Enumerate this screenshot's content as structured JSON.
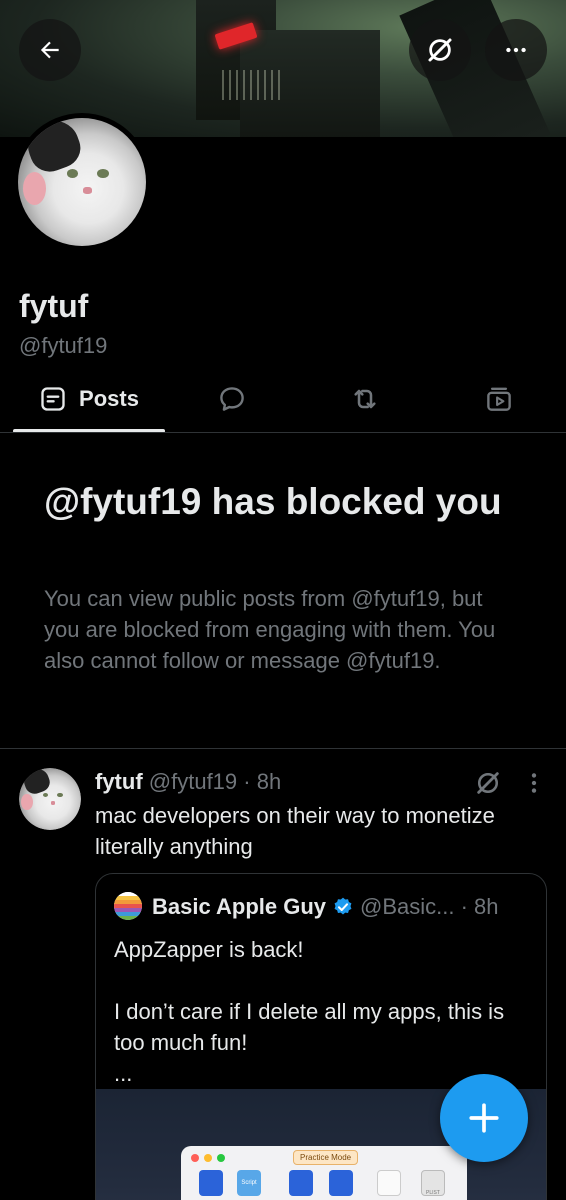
{
  "header": {
    "back_icon": "arrow-left-icon",
    "grok_icon": "grok-icon",
    "more_icon": "more-horizontal-icon"
  },
  "profile": {
    "display_name": "fytuf",
    "handle": "@fytuf19"
  },
  "tabs": [
    {
      "label": "Posts",
      "icon": "posts-icon",
      "selected": true
    },
    {
      "label": "",
      "icon": "replies-icon",
      "selected": false
    },
    {
      "label": "",
      "icon": "reposts-icon",
      "selected": false
    },
    {
      "label": "",
      "icon": "media-icon",
      "selected": false
    }
  ],
  "blocked": {
    "title": "@fytuf19 has blocked you",
    "description": "You can view public posts from @fytuf19, but you are blocked from engaging with them. You also cannot follow or message @fytuf19."
  },
  "post": {
    "name": "fytuf",
    "meta": "@fytuf19 · 8h",
    "text": "mac developers on their way to monetize literally anything",
    "quote": {
      "name": "Basic Apple Guy",
      "meta": "@Basic... · 8h",
      "lines": [
        "AppZapper is back!",
        "",
        "I don’t care if I delete all my apps, this is too much fun!",
        "..."
      ],
      "media_badge": "Practice Mode",
      "media_labels": [
        "Script",
        "PLIST"
      ]
    }
  },
  "fab": {
    "icon": "plus-icon"
  },
  "colors": {
    "background": "#000000",
    "text_primary": "#e7e9ea",
    "text_secondary": "#71767b",
    "divider": "#2f3336",
    "accent": "#1d9bf0"
  }
}
